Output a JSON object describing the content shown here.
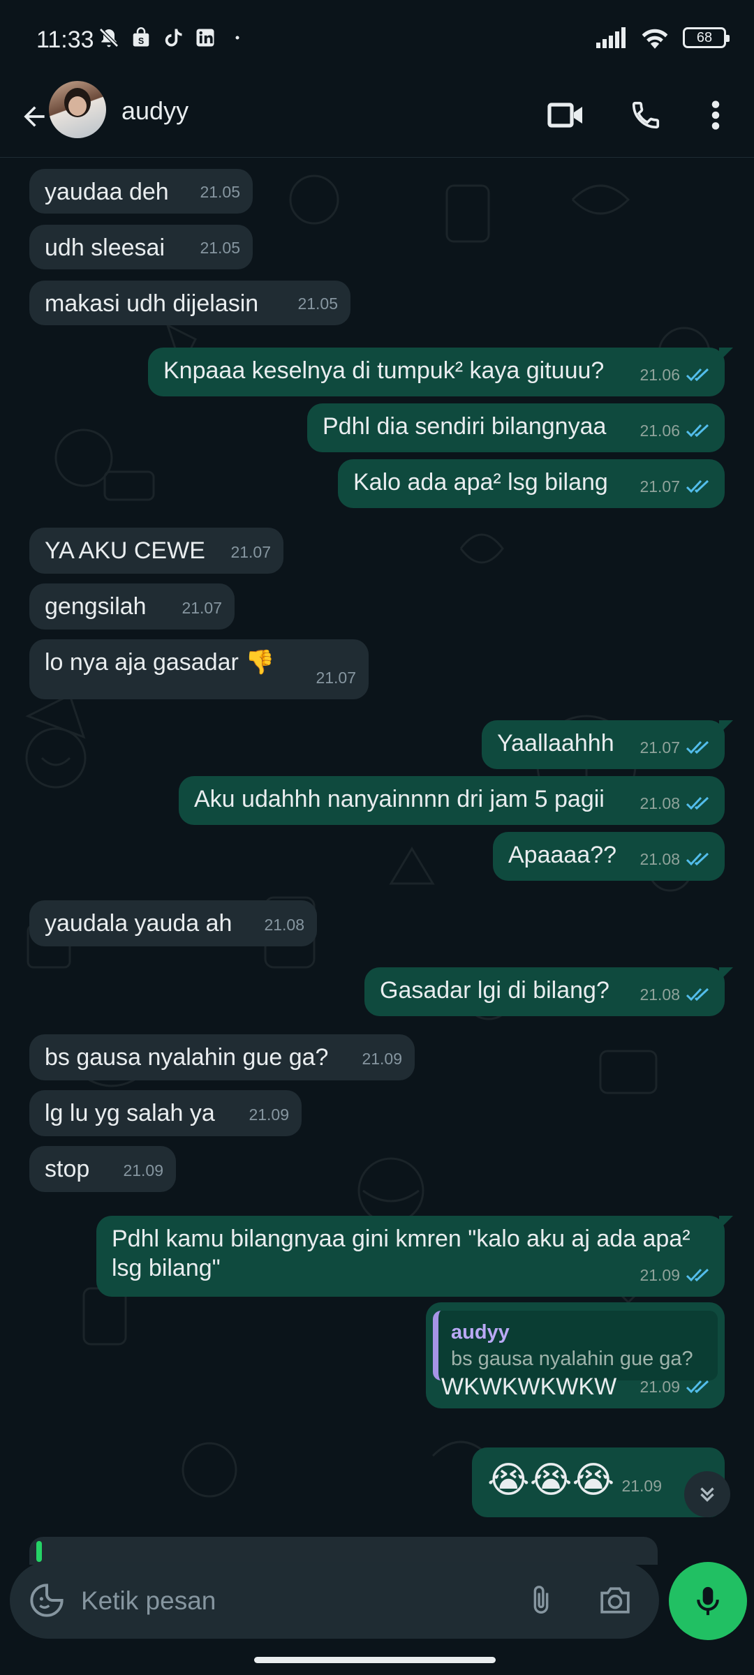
{
  "status_bar": {
    "time": "11:33",
    "battery": "68",
    "left_icons": [
      "mute-bell-icon",
      "shopping-bag-icon",
      "tiktok-icon",
      "linkedin-icon",
      "dot-icon"
    ],
    "right_icons": [
      "signal-icon",
      "wifi-icon",
      "battery-icon"
    ]
  },
  "header": {
    "contact_name": "audyy",
    "icons": [
      "back-arrow-icon",
      "video-call-icon",
      "phone-icon",
      "more-vert-icon"
    ]
  },
  "messages": [
    {
      "dir": "in",
      "text": "yaudaa deh",
      "time": "21.05"
    },
    {
      "dir": "in",
      "text": "udh sleesai",
      "time": "21.05"
    },
    {
      "dir": "in",
      "text": "makasi udh dijelasin",
      "time": "21.05"
    },
    {
      "dir": "out",
      "text": "Knpaaa keselnya di tumpuk² kaya gituuu?",
      "time": "21.06"
    },
    {
      "dir": "out",
      "text": "Pdhl dia sendiri bilangnyaa",
      "time": "21.06"
    },
    {
      "dir": "out",
      "text": "Kalo ada apa² lsg bilang",
      "time": "21.07"
    },
    {
      "dir": "in",
      "text": "YA AKU CEWE",
      "time": "21.07"
    },
    {
      "dir": "in",
      "text": "gengsilah",
      "time": "21.07"
    },
    {
      "dir": "in",
      "text": "lo nya aja gasadar 👎",
      "time": "21.07"
    },
    {
      "dir": "out",
      "text": "Yaallaahhh",
      "time": "21.07"
    },
    {
      "dir": "out",
      "text": "Aku udahhh nanyainnnn dri jam 5 pagii",
      "time": "21.08"
    },
    {
      "dir": "out",
      "text": "Apaaaa??",
      "time": "21.08"
    },
    {
      "dir": "in",
      "text": "yaudala yauda ah",
      "time": "21.08"
    },
    {
      "dir": "out",
      "text": "Gasadar lgi di bilang?",
      "time": "21.08"
    },
    {
      "dir": "in",
      "text": "bs gausa nyalahin gue ga?",
      "time": "21.09"
    },
    {
      "dir": "in",
      "text": "lg lu yg salah ya",
      "time": "21.09"
    },
    {
      "dir": "in",
      "text": "stop",
      "time": "21.09"
    },
    {
      "dir": "out",
      "text": "Pdhl kamu bilangnyaa gini kmren \"kalo aku aj ada apa² lsg bilang\"",
      "time": "21.09"
    },
    {
      "dir": "out",
      "text": "WKWKWKWKW",
      "time": "21.09",
      "quote_name": "audyy",
      "quote_text": "bs gausa nyalahin gue ga?"
    },
    {
      "dir": "out",
      "text": "😭😭😭",
      "time": "21.09"
    }
  ],
  "input": {
    "placeholder": "Ketik pesan"
  },
  "colors": {
    "background": "#0b141a",
    "incoming_bubble": "#202c33",
    "outgoing_bubble": "#0f4a3e",
    "read_tick": "#53bdeb",
    "accent_green": "#21c063",
    "quote_accent": "#a695e7"
  }
}
